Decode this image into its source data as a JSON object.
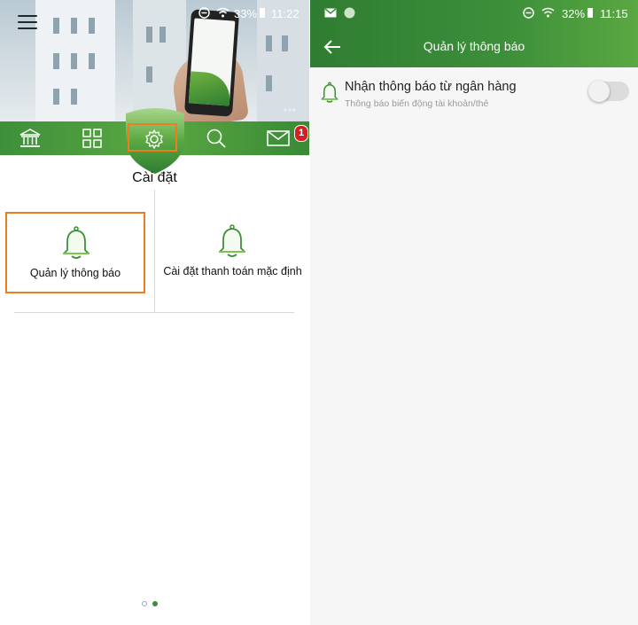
{
  "left": {
    "status": {
      "percent": "33%",
      "time": "11:22"
    },
    "more": "°°°",
    "badge_count": "1",
    "settings_title": "Cài đặt",
    "tiles": [
      {
        "label": "Quản lý thông báo",
        "highlighted": true
      },
      {
        "label": "Cài đặt thanh toán mặc định",
        "highlighted": false
      }
    ],
    "nav_icons": [
      "bank-icon",
      "grid-icon",
      "gear-icon",
      "search-icon",
      "mail-icon"
    ],
    "page_indicator": {
      "pages": 2,
      "active": 2
    }
  },
  "right": {
    "status": {
      "percent": "32%",
      "time": "11:15"
    },
    "title": "Quản lý thông báo",
    "setting_row": {
      "title": "Nhận thông báo từ ngân hàng",
      "subtitle": "Thông báo biến động tài khoản/thẻ",
      "enabled": false
    }
  },
  "colors": {
    "brand_green": "#3d8f3a",
    "highlight_orange": "#ee7d22",
    "badge_red": "#d51f26"
  }
}
